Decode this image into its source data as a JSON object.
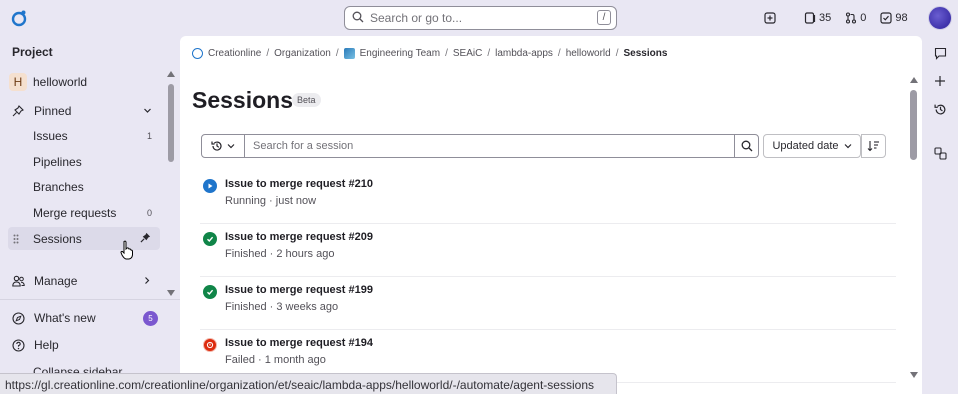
{
  "topbar": {
    "search_placeholder": "Search or go to...",
    "search_shortcut": "/",
    "issues_count": "35",
    "mr_count": "0",
    "todo_count": "98"
  },
  "sidebar": {
    "section_title": "Project",
    "project_initial": "H",
    "project_name": "helloworld",
    "pinned_label": "Pinned",
    "items": [
      {
        "label": "Issues",
        "count": "1"
      },
      {
        "label": "Pipelines",
        "count": ""
      },
      {
        "label": "Branches",
        "count": ""
      },
      {
        "label": "Merge requests",
        "count": "0"
      },
      {
        "label": "Sessions",
        "count": ""
      }
    ],
    "manage_label": "Manage",
    "whats_new_label": "What's new",
    "whats_new_badge": "5",
    "help_label": "Help",
    "collapse_label": "Collapse sidebar"
  },
  "breadcrumbs": [
    "Creationline",
    "Organization",
    "Engineering Team",
    "SEAiC",
    "lambda-apps",
    "helloworld",
    "Sessions"
  ],
  "page": {
    "title": "Sessions",
    "badge": "Beta",
    "filter_placeholder": "Search for a session",
    "sort_label": "Updated date"
  },
  "sessions": [
    {
      "title": "Issue to merge request #210",
      "meta": "Running · just now",
      "status": "running",
      "color": "#1f75cb"
    },
    {
      "title": "Issue to merge request #209",
      "meta": "Finished · 2 hours ago",
      "status": "finished",
      "color": "#108548"
    },
    {
      "title": "Issue to merge request #199",
      "meta": "Finished · 3 weeks ago",
      "status": "finished",
      "color": "#108548"
    },
    {
      "title": "Issue to merge request #194",
      "meta": "Failed · 1 month ago",
      "status": "failed",
      "color": "#dd2b0e"
    }
  ],
  "status_url": "https://gl.creationline.com/creationline/organization/et/seaic/lambda-apps/helloworld/-/automate/agent-sessions"
}
